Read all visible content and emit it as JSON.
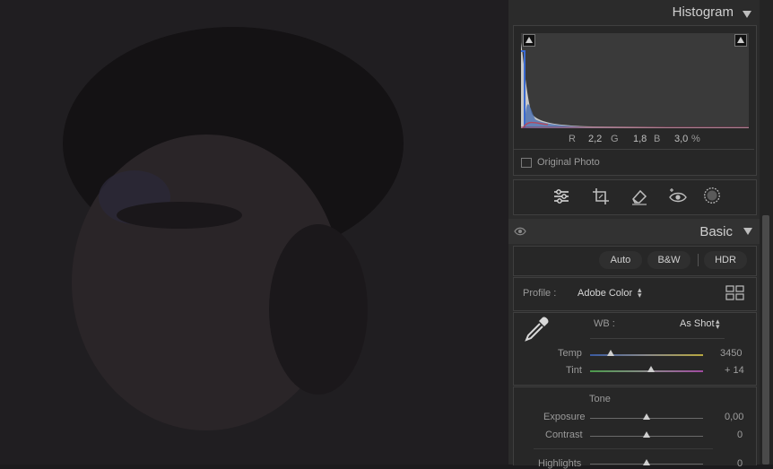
{
  "histogram": {
    "title": "Histogram",
    "r_label": "R",
    "r_value": "2,2",
    "g_label": "G",
    "g_value": "1,8",
    "b_label": "B",
    "b_value": "3,0",
    "percent": "%",
    "original_photo_label": "Original Photo"
  },
  "tools": [
    "sliders-icon",
    "crop-icon",
    "eraser-icon",
    "red-eye-icon",
    "masking-icon"
  ],
  "basic": {
    "title": "Basic",
    "auto_label": "Auto",
    "bw_label": "B&W",
    "hdr_label": "HDR",
    "profile_label": "Profile :",
    "profile_value": "Adobe Color",
    "wb_label": "WB :",
    "wb_value": "As Shot",
    "temp_label": "Temp",
    "temp_value": "3450",
    "tint_label": "Tint",
    "tint_value": "+ 14",
    "tone_label": "Tone",
    "exposure_label": "Exposure",
    "exposure_value": "0,00",
    "contrast_label": "Contrast",
    "contrast_value": "0",
    "highlights_label": "Highlights",
    "highlights_value": "0"
  },
  "colors": {
    "panel": "#2b2b2b",
    "accent": "#cfcfcf"
  }
}
